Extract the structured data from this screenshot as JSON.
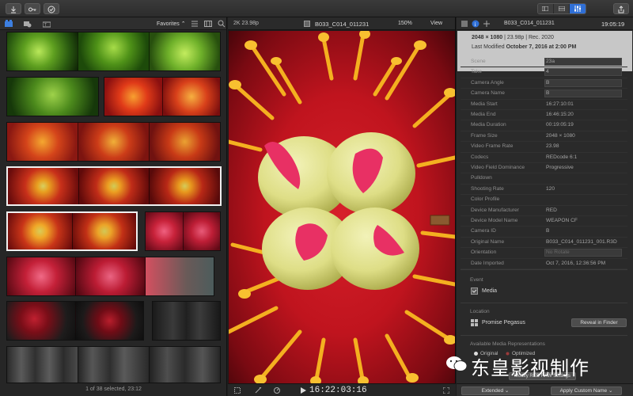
{
  "toolbar": {
    "import_icon": "download-arrow-icon",
    "keywords_icon": "key-icon",
    "analyze_icon": "checkmark-circle-icon",
    "share_icon": "share-icon",
    "accent": "#2f6fd6"
  },
  "browser": {
    "filter_label": "Favorites ⌃",
    "status": "1 of 38 selected, 23:12"
  },
  "viewer": {
    "format": "2K 23.98p",
    "clip_name": "B033_C014_011231",
    "zoom": "150%",
    "view_menu": "View",
    "timecode": "16:22:03:16"
  },
  "inspector": {
    "title": "B033_C014_011231",
    "duration": "19:05:19",
    "summary_line1_a": "2048 × 1080",
    "summary_line1_b": " | 23.98p | Rec. 2020",
    "summary_line2_prefix": "Last Modified ",
    "summary_line2_date": "October 7, 2016 at 2:00 PM",
    "fields": [
      {
        "key": "Scene",
        "value": "23a",
        "box": true
      },
      {
        "key": "Take",
        "value": "4",
        "box": true
      },
      {
        "key": "Camera Angle",
        "value": "B",
        "box": true
      },
      {
        "key": "Camera Name",
        "value": "B",
        "box": true
      },
      {
        "key": "Media Start",
        "value": "16:27:10:01",
        "box": false
      },
      {
        "key": "Media End",
        "value": "16:46:15:20",
        "box": false
      },
      {
        "key": "Media Duration",
        "value": "00:19:05:19",
        "box": false
      },
      {
        "key": "Frame Size",
        "value": "2048 × 1080",
        "box": false
      },
      {
        "key": "Video Frame Rate",
        "value": "23.98",
        "box": false
      },
      {
        "key": "Codecs",
        "value": "REDcode 6:1",
        "box": false
      },
      {
        "key": "Video Field Dominance",
        "value": "Progressive",
        "box": false
      },
      {
        "key": "Pulldown",
        "value": "",
        "box": false
      },
      {
        "key": "Shooting Rate",
        "value": "120",
        "box": false
      },
      {
        "key": "Color Profile",
        "value": "",
        "box": false
      },
      {
        "key": "Device Manufacturer",
        "value": "RED",
        "box": false
      },
      {
        "key": "Device Model Name",
        "value": "WEAPON CF",
        "box": false
      },
      {
        "key": "Camera ID",
        "value": "B",
        "box": false
      },
      {
        "key": "Original Name",
        "value": "B033_C014_011231_001.R3D",
        "box": false
      },
      {
        "key": "Orientation",
        "value": "No Rotate",
        "box": true
      },
      {
        "key": "Date Imported",
        "value": "Oct 7, 2016, 12:36:56 PM",
        "box": false
      }
    ],
    "event_label": "Event",
    "event_value": "Media",
    "location_label": "Location",
    "location_value": "Promise Pegasus",
    "reveal_button": "Reveal in Finder",
    "representations_label": "Available Media Representations",
    "rep_original": "Original",
    "rep_optimized": "Optimized",
    "raw_settings_button": "Modify RED RAW Settings",
    "extended_menu": "Extended",
    "apply_button": "Apply Custom Name"
  },
  "watermark": {
    "text": "东皇影视制作"
  }
}
